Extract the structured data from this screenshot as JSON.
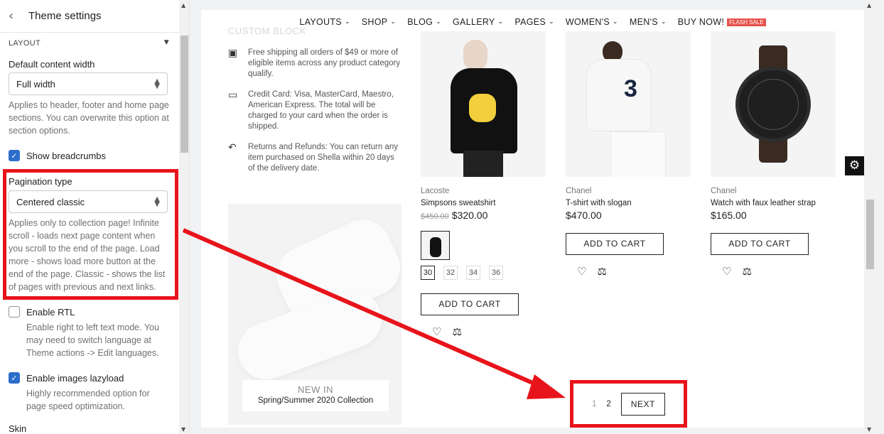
{
  "sidebar": {
    "title": "Theme settings",
    "section": "LAYOUT",
    "content_width": {
      "label": "Default content width",
      "value": "Full width",
      "help": "Applies to header, footer and home page sections. You can overwrite this option at section options."
    },
    "breadcrumbs": {
      "label": "Show breadcrumbs",
      "checked": true
    },
    "pagination": {
      "label": "Pagination type",
      "value": "Centered classic",
      "help": "Applies only to collection page! Infinite scroll - loads next page content when you scroll to the end of the page. Load more - shows load more button at the end of the page. Classic - shows the list of pages with previous and next links."
    },
    "rtl": {
      "label": "Enable RTL",
      "checked": false,
      "help": "Enable right to left text mode. You may need to switch language at Theme actions -> Edit languages."
    },
    "lazyload": {
      "label": "Enable images lazyload",
      "checked": true,
      "help": "Highly recommended option for page speed optimization."
    },
    "next_section": "Skin"
  },
  "nav": {
    "items": [
      "LAYOUTS",
      "SHOP",
      "BLOG",
      "GALLERY",
      "PAGES",
      "WOMEN'S",
      "MEN'S"
    ],
    "buy_now": "BUY NOW!",
    "flash_badge": "FLASH SALE"
  },
  "custom_block": {
    "title": "CUSTOM BLOCK",
    "items": [
      {
        "icon": "package-icon",
        "text": "Free shipping all orders of $49 or more of eligible items across any product category qualify."
      },
      {
        "icon": "credit-card-icon",
        "text": "Credit Card: Visa, MasterCard, Maestro, American Express. The total will be charged to your card when the order is shipped."
      },
      {
        "icon": "return-icon",
        "text": "Returns and Refunds: You can return any item purchased on Shella within 20 days of the delivery date."
      }
    ]
  },
  "promo": {
    "title": "NEW IN",
    "subtitle": "Spring/Summer 2020 Collection"
  },
  "products": [
    {
      "brand": "Lacoste",
      "name": "Simpsons sweatshirt",
      "old_price": "$450.00",
      "price": "$320.00",
      "sizes": [
        "30",
        "32",
        "34",
        "36"
      ],
      "button": "ADD TO CART"
    },
    {
      "brand": "Chanel",
      "name": "T-shirt with slogan",
      "price": "$470.00",
      "button": "ADD TO CART"
    },
    {
      "brand": "Chanel",
      "name": "Watch with faux leather strap",
      "price": "$165.00",
      "button": "ADD TO CART"
    }
  ],
  "pagination": {
    "pages": [
      "1",
      "2"
    ],
    "next": "NEXT"
  },
  "colors": {
    "highlight": "#e8141b",
    "accent": "#2c6ecb",
    "flash": "#e8514a"
  }
}
